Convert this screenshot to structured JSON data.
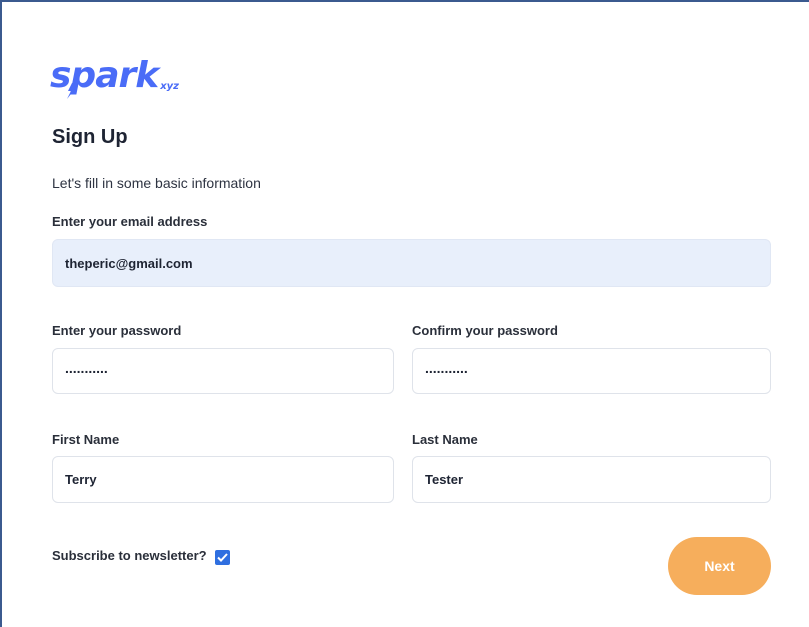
{
  "brand": {
    "name": "spark",
    "suffix": "xyz",
    "color": "#4a6cf7"
  },
  "form": {
    "title": "Sign Up",
    "subtitle": "Let's fill in some basic information",
    "email": {
      "label": "Enter your email address",
      "value": "theperic@gmail.com"
    },
    "password": {
      "label": "Enter your password",
      "value": "..........."
    },
    "confirm_password": {
      "label": "Confirm your password",
      "value": "..........."
    },
    "first_name": {
      "label": "First Name",
      "value": "Terry"
    },
    "last_name": {
      "label": "Last Name",
      "value": "Tester"
    },
    "newsletter": {
      "label": "Subscribe to newsletter?",
      "checked": true
    },
    "next_label": "Next",
    "next_color": "#f6ae5c"
  }
}
